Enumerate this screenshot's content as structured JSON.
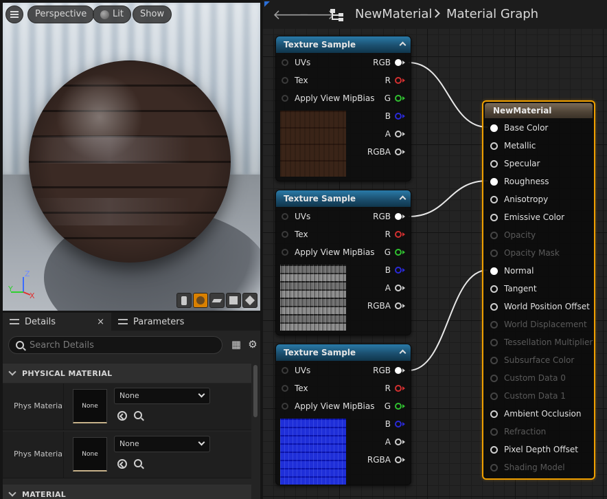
{
  "viewport": {
    "perspective_label": "Perspective",
    "lit_label": "Lit",
    "show_label": "Show",
    "axis_z": "Z",
    "axis_y": "Y",
    "axis_x": "X"
  },
  "details_panel": {
    "tabs": [
      {
        "label": "Details",
        "close": "×"
      },
      {
        "label": "Parameters"
      }
    ],
    "search_placeholder": "Search Details",
    "sections": [
      {
        "title": "PHYSICAL MATERIAL"
      },
      {
        "title": "MATERIAL"
      }
    ],
    "rows": [
      {
        "label": "Phys Material",
        "thumb_text": "None",
        "combo_value": "None"
      },
      {
        "label": "Phys Material",
        "thumb_text": "None",
        "combo_value": "None"
      }
    ]
  },
  "graph": {
    "breadcrumb_asset": "NewMaterial",
    "breadcrumb_graph": "Material Graph",
    "texture_nodes": [
      {
        "title": "Texture Sample",
        "inputs": [
          "UVs",
          "Tex",
          "Apply View MipBias"
        ],
        "outputs": [
          "RGB",
          "R",
          "G",
          "B",
          "A",
          "RGBA"
        ],
        "preview": "wood"
      },
      {
        "title": "Texture Sample",
        "inputs": [
          "UVs",
          "Tex",
          "Apply View MipBias"
        ],
        "outputs": [
          "RGB",
          "R",
          "G",
          "B",
          "A",
          "RGBA"
        ],
        "preview": "roughness"
      },
      {
        "title": "Texture Sample",
        "inputs": [
          "UVs",
          "Tex",
          "Apply View MipBias"
        ],
        "outputs": [
          "RGB",
          "R",
          "G",
          "B",
          "A",
          "RGBA"
        ],
        "preview": "normal"
      }
    ],
    "result_node": {
      "title": "NewMaterial",
      "pins": [
        {
          "label": "Base Color",
          "enabled": true,
          "connected": true
        },
        {
          "label": "Metallic",
          "enabled": true,
          "connected": false
        },
        {
          "label": "Specular",
          "enabled": true,
          "connected": false
        },
        {
          "label": "Roughness",
          "enabled": true,
          "connected": true
        },
        {
          "label": "Anisotropy",
          "enabled": true,
          "connected": false
        },
        {
          "label": "Emissive Color",
          "enabled": true,
          "connected": false
        },
        {
          "label": "Opacity",
          "enabled": false,
          "connected": false
        },
        {
          "label": "Opacity Mask",
          "enabled": false,
          "connected": false
        },
        {
          "label": "Normal",
          "enabled": true,
          "connected": true
        },
        {
          "label": "Tangent",
          "enabled": true,
          "connected": false
        },
        {
          "label": "World Position Offset",
          "enabled": true,
          "connected": false
        },
        {
          "label": "World Displacement",
          "enabled": false,
          "connected": false
        },
        {
          "label": "Tessellation Multiplier",
          "enabled": false,
          "connected": false
        },
        {
          "label": "Subsurface Color",
          "enabled": false,
          "connected": false
        },
        {
          "label": "Custom Data 0",
          "enabled": false,
          "connected": false
        },
        {
          "label": "Custom Data 1",
          "enabled": false,
          "connected": false
        },
        {
          "label": "Ambient Occlusion",
          "enabled": true,
          "connected": false
        },
        {
          "label": "Refraction",
          "enabled": false,
          "connected": false
        },
        {
          "label": "Pixel Depth Offset",
          "enabled": true,
          "connected": false
        },
        {
          "label": "Shading Model",
          "enabled": false,
          "connected": false
        }
      ]
    }
  },
  "colors": {
    "accent_orange": "#f0a000",
    "node_header_blue": "#1b4f6f",
    "pin_r": "#d23030",
    "pin_g": "#30c030",
    "pin_b": "#2a2ad8"
  }
}
